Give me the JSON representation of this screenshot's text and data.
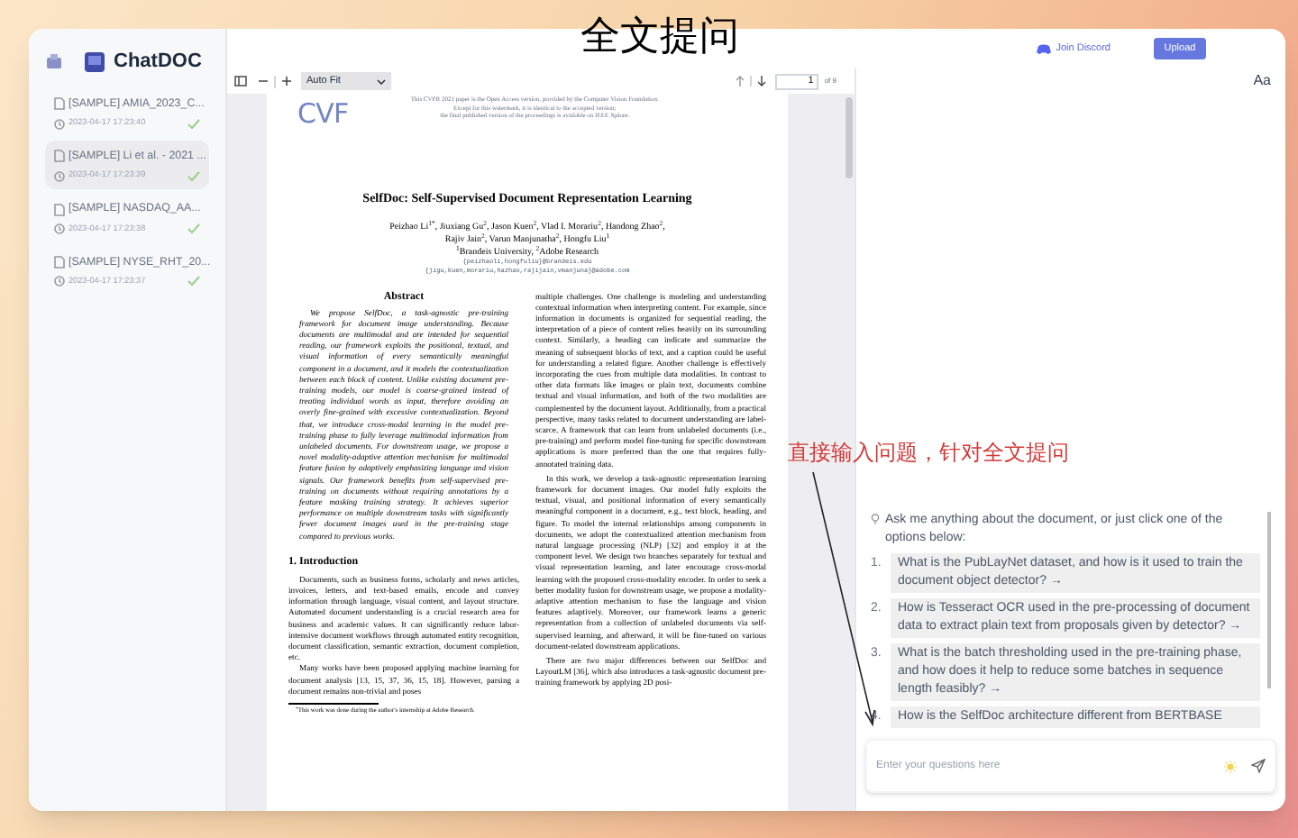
{
  "annotations": {
    "title": "全文提问",
    "note": "直接输入问题，针对全文提问"
  },
  "app": {
    "name": "ChatDOC"
  },
  "documents": [
    {
      "title": "[SAMPLE] AMIA_2023_C...",
      "time": "2023-04-17 17:23:40",
      "selected": false
    },
    {
      "title": "[SAMPLE] Li et al. - 2021 ...",
      "time": "2023-04-17 17:23:39",
      "selected": true
    },
    {
      "title": "[SAMPLE] NASDAQ_AA...",
      "time": "2023-04-17 17:23:38",
      "selected": false
    },
    {
      "title": "[SAMPLE] NYSE_RHT_20...",
      "time": "2023-04-17 17:23:37",
      "selected": false
    }
  ],
  "header": {
    "discord": "Join Discord",
    "upload": "Upload"
  },
  "viewer": {
    "zoom": "Auto Fit",
    "page": "1",
    "page_total": "of 9",
    "font_button": "Aa"
  },
  "paper": {
    "notice": [
      "This CVPR 2021 paper is the Open Access version, provided by the Computer Vision Foundation.",
      "Except for this watermark, it is identical to the accepted version;",
      "the final published version of the proceedings is available on IEEE Xplore."
    ],
    "logo": "CVF",
    "title": "SelfDoc: Self-Supervised Document Representation Learning",
    "authors": [
      "Peizhao Li$^{1*}$, Jiuxiang Gu$^{2}$, Jason Kuen$^{2}$, Vlad I. Morariu$^{2}$, Handong Zhao$^{2}$,",
      "Rajiv Jain$^{2}$, Varun Manjunatha$^{2}$, Hongfu Liu$^{1}$",
      "$^{1}$Brandeis University, $^{2}$Adobe Research"
    ],
    "emails": [
      "{peizhaoli,hongfuliu}@brandeis.edu",
      "{jigu,kuen,morariu,hazhao,rajijain,vmanjuna}@adobe.com"
    ],
    "abstract_heading": "Abstract",
    "abstract": "We propose SelfDoc, a task-agnostic pre-training framework for document image understanding. Because documents are multimodal and are intended for sequential reading, our framework exploits the positional, textual, and visual information of every semantically meaningful component in a document, and it models the contextualization between each block of content. Unlike existing document pre-training models, our model is coarse-grained instead of treating individual words as input, therefore avoiding an overly fine-grained with excessive contextualization. Beyond that, we introduce cross-modal learning in the model pre-training phase to fully leverage multimodal information from unlabeled documents. For downstream usage, we propose a novel modality-adaptive attention mechanism for multimodal feature fusion by adaptively emphasizing language and vision signals. Our framework benefits from self-supervised pre-training on documents without requiring annotations by a feature masking training strategy. It achieves superior performance on multiple downstream tasks with significantly fewer document images used in the pre-training stage compared to previous works.",
    "intro_heading": "1. Introduction",
    "left_paragraphs": [
      "Documents, such as business forms, scholarly and news articles, invoices, letters, and text-based emails, encode and convey information through language, visual content, and layout structure. Automated document understanding is a crucial research area for business and academic values. It can significantly reduce labor-intensive document workflows through automated entity recognition, document classification, semantic extraction, document completion, etc.",
      "Many works have been proposed applying machine learning for document analysis [13, 15, 37, 36, 15, 18]. However, parsing a document remains non-trivial and poses"
    ],
    "footnote": "$^{*}$This work was done during the author's internship at Adobe Research.",
    "right_paragraphs": [
      "multiple challenges. One challenge is modeling and understanding contextual information when interpreting content. For example, since information in documents is organized for sequential reading, the interpretation of a piece of content relies heavily on its surrounding context. Similarly, a heading can indicate and summarize the meaning of subsequent blocks of text, and a caption could be useful for understanding a related figure. Another challenge is effectively incorporating the cues from multiple data modalities. In contrast to other data formats like images or plain text, documents combine textual and visual information, and both of the two modalities are complemented by the document layout. Additionally, from a practical perspective, many tasks related to document understanding are label-scarce. A framework that can learn from unlabeled documents (i.e., pre-training) and perform model fine-tuning for specific downstream applications is more preferred than the one that requires fully-annotated training data.",
      "In this work, we develop a task-agnostic representation learning framework for document images. Our model fully exploits the textual, visual, and positional information of every semantically meaningful component in a document, e.g., text block, heading, and figure. To model the internal relationships among components in documents, we adopt the contextualized attention mechanism from natural language processing (NLP) [32] and employ it at the component level. We design two branches separately for textual and visual representation learning, and later encourage cross-modal learning with the proposed cross-modality encoder. In order to seek a better modality fusion for downstream usage, we propose a modality-adaptive attention mechanism to fuse the language and vision features adaptively. Moreover, our framework learns a generic representation from a collection of unlabeled documents via self-supervised learning, and afterward, it will be fine-tuned on various document-related downstream applications.",
      "There are two major differences between our SelfDoc and LayoutLM [36], which also introduces a task-agnostic document pre-training framework by applying 2D posi-"
    ]
  },
  "chat": {
    "intro": "Ask me anything about the document, or just click one of the options below:",
    "suggestions": [
      {
        "number": "1.",
        "text": "What is the PubLayNet dataset, and how is it used to train the document object detector? →"
      },
      {
        "number": "2.",
        "text": "How is Tesseract OCR used in the pre-processing of document data to extract plain text from proposals given by detector? →"
      },
      {
        "number": "3.",
        "text": "What is the batch thresholding used in the pre-training phase, and how does it help to reduce some batches in sequence length feasibly? →"
      },
      {
        "number": "4.",
        "text": "How is the SelfDoc architecture different from BERTBASE"
      }
    ],
    "input": {
      "placeholder": "Enter your questions here"
    }
  }
}
